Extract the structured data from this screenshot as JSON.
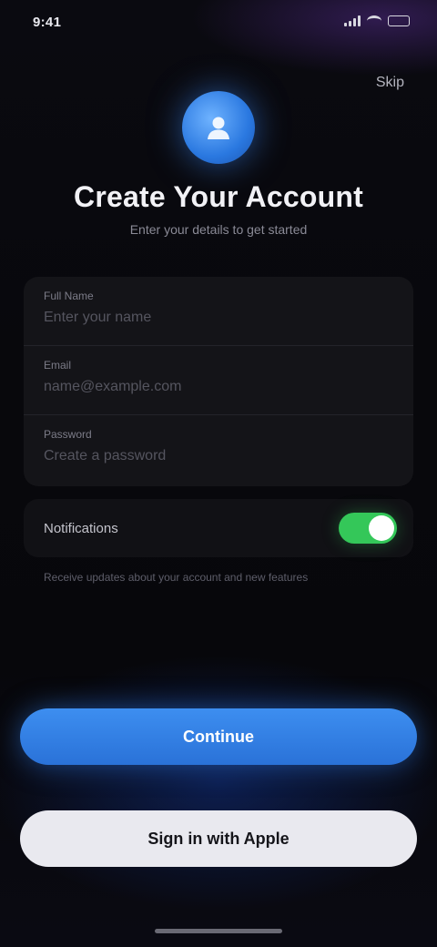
{
  "status_bar": {
    "time": "9:41"
  },
  "header": {
    "skip_label": "Skip",
    "app_icon": "user-icon",
    "title": "Create Your Account",
    "subtitle": "Enter your details to get started"
  },
  "form": {
    "fields": [
      {
        "label": "Full Name",
        "placeholder": "Enter your name"
      },
      {
        "label": "Email",
        "placeholder": "name@example.com"
      },
      {
        "label": "Password",
        "placeholder": "Create a password"
      }
    ]
  },
  "notifications": {
    "label": "Notifications",
    "enabled": true,
    "description": "Receive updates about your account and new features"
  },
  "actions": {
    "primary_label": "Continue",
    "secondary_label": "Sign in with Apple"
  },
  "colors": {
    "accent": "#3d8ef0",
    "toggle_on": "#34c759",
    "background": "#06060a",
    "card": "#141418"
  }
}
